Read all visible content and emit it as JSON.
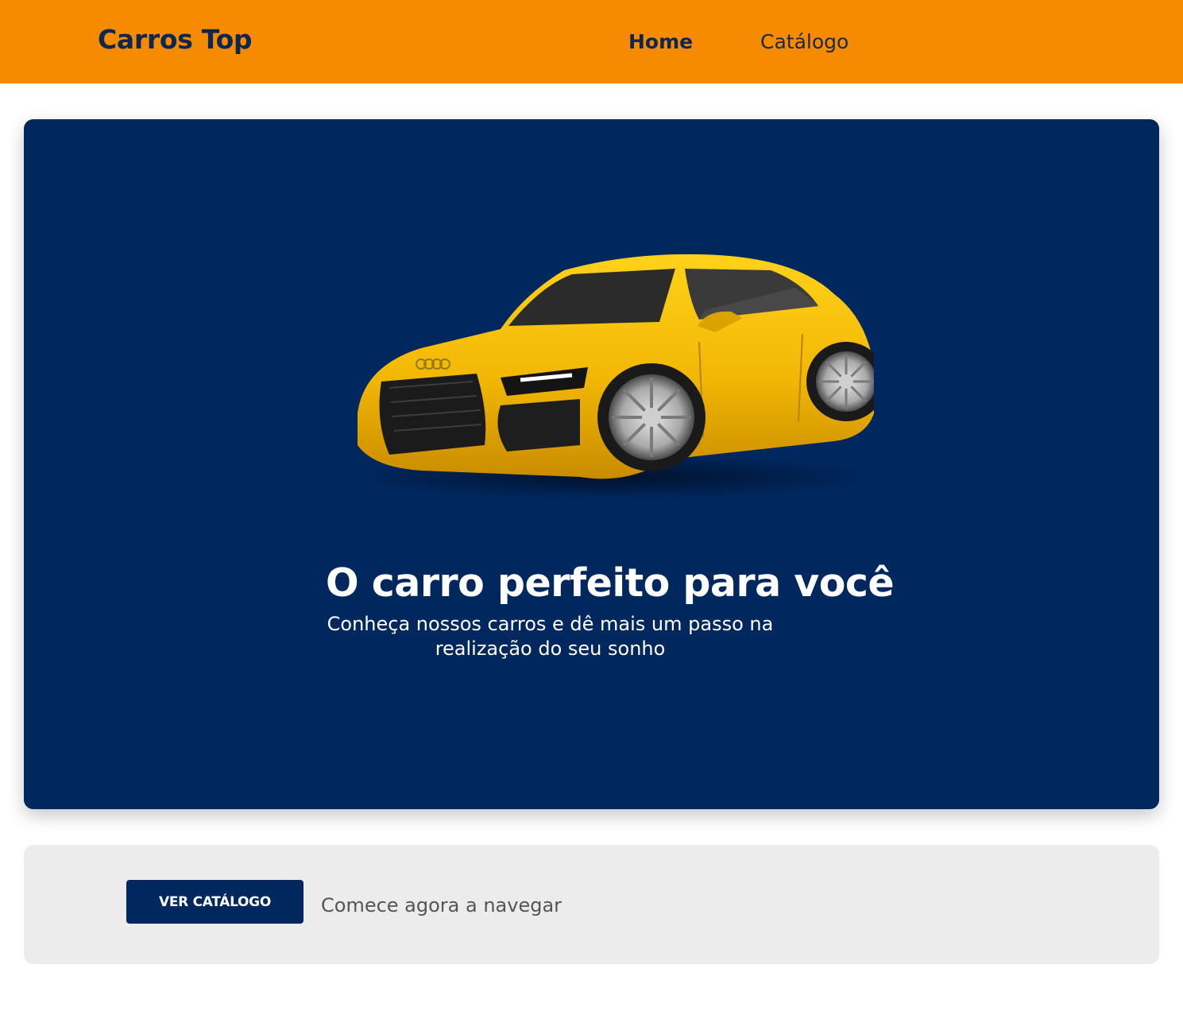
{
  "header": {
    "brand": "Carros Top",
    "nav": [
      {
        "label": "Home",
        "active": true
      },
      {
        "label": "Catálogo",
        "active": false
      }
    ]
  },
  "hero": {
    "image_icon": "yellow-sports-car-image",
    "title": "O carro perfeito para você",
    "subtitle": "Conheça nossos carros e dê mais um passo na realização do seu sonho"
  },
  "cta": {
    "button_label": "VER CATÁLOGO",
    "text": "Comece agora a navegar"
  },
  "colors": {
    "header_bg": "#f68a00",
    "hero_bg": "#00275e",
    "car_body": "#f2b705",
    "cta_bg": "#ececec",
    "brand_text": "#0d2752"
  }
}
